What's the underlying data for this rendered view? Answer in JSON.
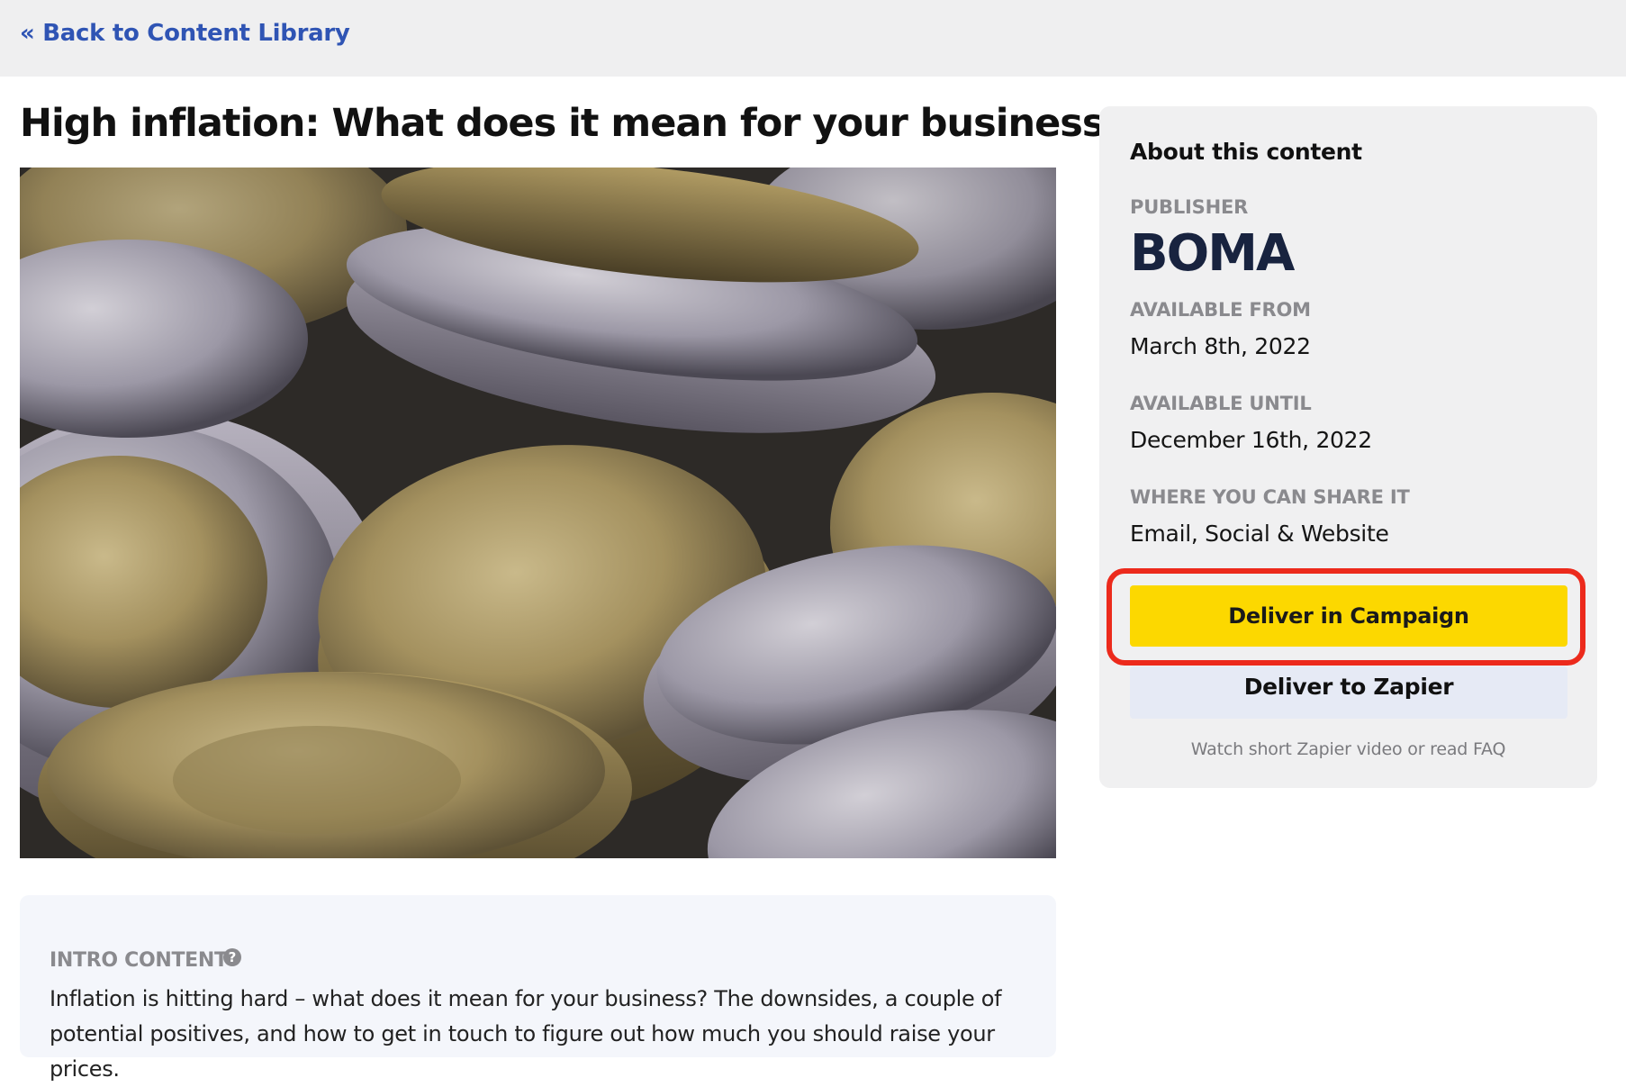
{
  "nav": {
    "back_link": "« Back to Content Library"
  },
  "article": {
    "title": "High inflation: What does it mean for your business?",
    "image_alt": "coins",
    "intro_label": "INTRO CONTENT",
    "intro_text": "Inflation is hitting hard – what does it mean for your business? The downsides, a couple of potential positives, and how to get in touch to figure out how much you should raise your prices."
  },
  "sidebar": {
    "heading": "About this content",
    "publisher_label": "PUBLISHER",
    "publisher_logo_text": "BOMA",
    "available_from_label": "AVAILABLE FROM",
    "available_from": "March 8th, 2022",
    "available_until_label": "AVAILABLE UNTIL",
    "available_until": "December 16th, 2022",
    "share_label": "WHERE YOU CAN SHARE IT",
    "share_value": "Email, Social & Website",
    "deliver_campaign_label": "Deliver in Campaign",
    "deliver_zapier_label": "Deliver to Zapier",
    "zapier_help": "Watch short Zapier video or read FAQ"
  },
  "colors": {
    "link": "#2f54b4",
    "campaign_button": "#fcd800",
    "zapier_button": "#e6eaf5",
    "highlight": "#ec2a1c",
    "logo": "#18233f"
  },
  "icons": {
    "help": "question-circle-icon"
  }
}
